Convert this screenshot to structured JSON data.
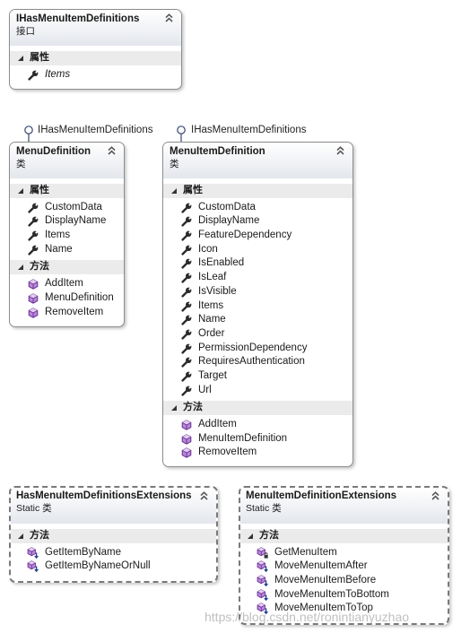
{
  "icons": {
    "property": "wrench-icon",
    "method": "method-icon",
    "extension_method": "extension-method-icon",
    "private_method": "private-method-icon",
    "collapse": "double-chevron-up-icon",
    "section_expanded": "expanded-triangle-icon",
    "interface_lollipop": "lollipop-icon"
  },
  "colors": {
    "header_top": "#ffffff",
    "header_bottom": "#e3e6ec",
    "section_band": "#ebebeb",
    "border": "#8d8d8d",
    "static_border": "#7a7a7a",
    "method_icon": "#8e4fc0",
    "property_icon": "#2b2b2b",
    "watermark": "#969696"
  },
  "interface_box": {
    "title": "IHasMenuItemDefinitions",
    "stereotype": "接口",
    "properties_label": "属性",
    "properties": [
      "Items"
    ]
  },
  "menu_definition": {
    "implements": "IHasMenuItemDefinitions",
    "title": "MenuDefinition",
    "stereotype": "类",
    "properties_label": "属性",
    "properties": [
      "CustomData",
      "DisplayName",
      "Items",
      "Name"
    ],
    "methods_label": "方法",
    "methods": [
      "AddItem",
      "MenuDefinition",
      "RemoveItem"
    ]
  },
  "menu_item_definition": {
    "implements": "IHasMenuItemDefinitions",
    "title": "MenuItemDefinition",
    "stereotype": "类",
    "properties_label": "属性",
    "properties": [
      "CustomData",
      "DisplayName",
      "FeatureDependency",
      "Icon",
      "IsEnabled",
      "IsLeaf",
      "IsVisible",
      "Items",
      "Name",
      "Order",
      "PermissionDependency",
      "RequiresAuthentication",
      "Target",
      "Url"
    ],
    "methods_label": "方法",
    "methods": [
      "AddItem",
      "MenuItemDefinition",
      "RemoveItem"
    ]
  },
  "has_menu_item_definitions_extensions": {
    "title": "HasMenuItemDefinitionsExtensions",
    "stereotype": "Static 类",
    "methods_label": "方法",
    "methods": [
      "GetItemByName",
      "GetItemByNameOrNull"
    ]
  },
  "menu_item_definition_extensions": {
    "title": "MenuItemDefinitionExtensions",
    "stereotype": "Static 类",
    "methods_label": "方法",
    "methods": [
      "GetMenuItem",
      "MoveMenuItemAfter",
      "MoveMenuItemBefore",
      "MoveMenuItemToBottom",
      "MoveMenuItemToTop"
    ]
  },
  "watermark": "https://blog.csdn.net/ronintianyuzhao"
}
